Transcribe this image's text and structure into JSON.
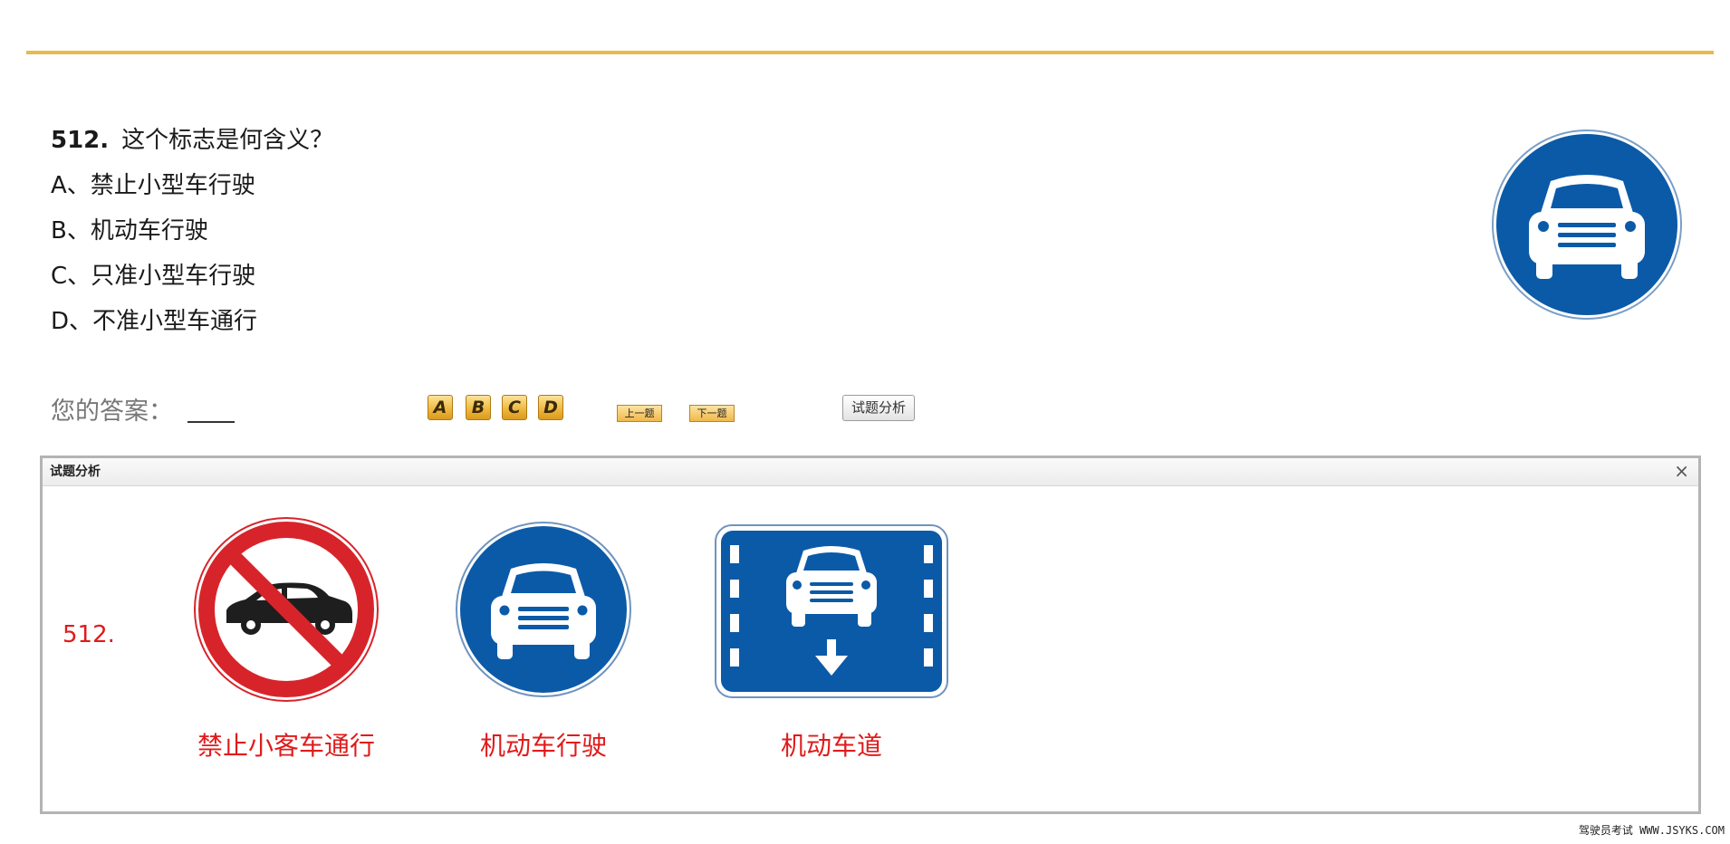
{
  "question": {
    "number": "512.",
    "text": "这个标志是何含义？",
    "options": [
      "A、禁止小型车行驶",
      "B、机动车行驶",
      "C、只准小型车行驶",
      "D、不准小型车通行"
    ]
  },
  "answer": {
    "label": "您的答案："
  },
  "choice_buttons": [
    "A",
    "B",
    "C",
    "D"
  ],
  "nav": {
    "prev": "上一题",
    "next": "下一题",
    "analysis": "试题分析"
  },
  "dialog": {
    "title": "试题分析",
    "close": "×",
    "ref_number": "512.",
    "signs": [
      {
        "caption": "禁止小客车通行",
        "icon": "no-car-sign-icon"
      },
      {
        "caption": "机动车行驶",
        "icon": "motor-vehicle-sign-icon"
      },
      {
        "caption": "机动车道",
        "icon": "motor-lane-sign-icon"
      }
    ]
  },
  "colors": {
    "accent_rule": "#e9b84e",
    "sign_blue": "#0b5aa8",
    "sign_red": "#d7242a",
    "caption_red": "#e01b1b"
  },
  "watermark": "驾驶员考试 WWW.JSYKS.COM"
}
